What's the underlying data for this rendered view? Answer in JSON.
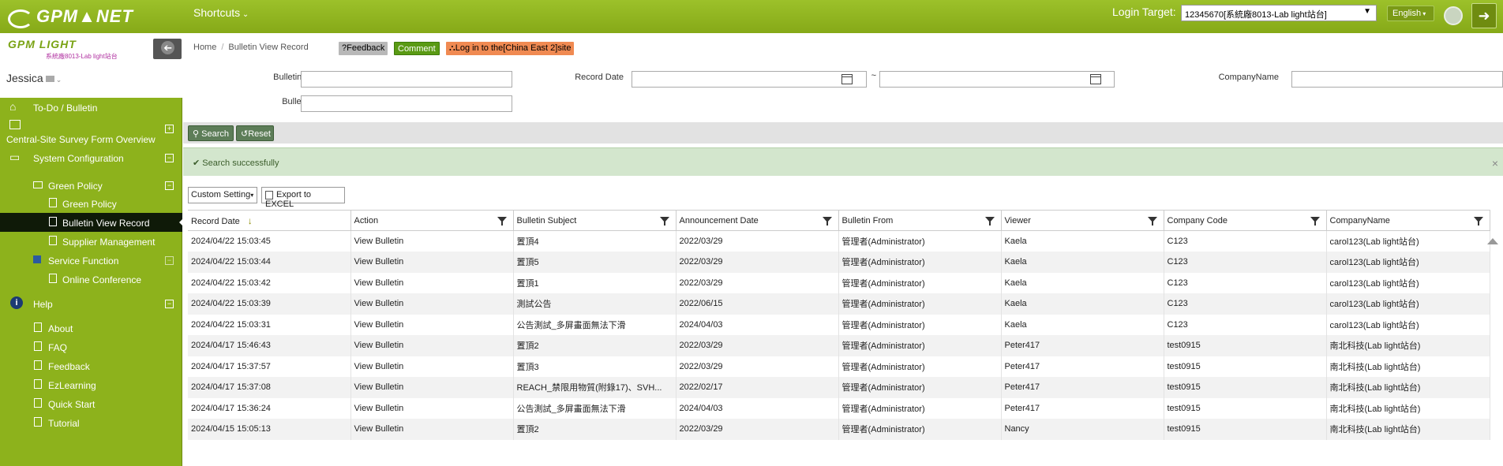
{
  "header": {
    "logo_text": "GPM▲NET",
    "shortcuts_label": "Shortcuts",
    "login_target_label": "Login Target:",
    "login_target_value": "12345670[系統廠8013-Lab light站台]",
    "language": "English",
    "colors": {
      "brand": "#8db21c",
      "dark": "#0f1a08"
    }
  },
  "sidebar": {
    "brand": "GPM LIGHT",
    "brand_sub": "系統廠8013-Lab light站台",
    "user_name": "Jessica",
    "items": [
      {
        "label": "To-Do / Bulletin",
        "icon": "home-icon"
      },
      {
        "label": "Central-Site Survey Form Overview",
        "icon": "pencil-icon",
        "toggle": "+"
      },
      {
        "label": "System Configuration",
        "icon": "monitor-icon",
        "toggle": "−"
      },
      {
        "label": "Green Policy",
        "icon": "folder-icon",
        "toggle": "−"
      },
      {
        "label": "Green Policy",
        "icon": "file-icon"
      },
      {
        "label": "Bulletin View Record",
        "icon": "file-icon",
        "active": true
      },
      {
        "label": "Supplier Management",
        "icon": "file-icon"
      },
      {
        "label": "Service Function",
        "icon": "book-icon",
        "toggle": "−"
      },
      {
        "label": "Online Conference",
        "icon": "file-icon"
      },
      {
        "label": "Help",
        "icon": "info-icon",
        "toggle": "−"
      },
      {
        "label": "About",
        "icon": "file-icon"
      },
      {
        "label": "FAQ",
        "icon": "file-icon"
      },
      {
        "label": "Feedback",
        "icon": "file-icon"
      },
      {
        "label": "EzLearning",
        "icon": "file-icon"
      },
      {
        "label": "Quick Start",
        "icon": "file-icon"
      },
      {
        "label": "Tutorial",
        "icon": "file-icon"
      }
    ]
  },
  "breadcrumb": {
    "home": "Home",
    "current": "Bulletin View Record"
  },
  "badges": {
    "feedback": "?Feedback",
    "comment": "Comment",
    "login": "Log in to the[China East 2]site"
  },
  "filters": {
    "bulletin_subject_label": "Bulletin Subject",
    "bulletin_subject_value": "",
    "record_date_label": "Record Date",
    "record_date_from": "",
    "record_date_sep": "~",
    "record_date_to": "",
    "company_name_label": "CompanyName",
    "company_name_value": "",
    "bulletin_from_label": "Bulletin From",
    "bulletin_from_value": ""
  },
  "actions": {
    "search": "Search",
    "reset": "Reset",
    "custom_setting": "Custom Setting",
    "export": "Export to EXCEL"
  },
  "message": "Search successfully",
  "table": {
    "columns": [
      "Record Date",
      "Action",
      "Bulletin Subject",
      "Announcement Date",
      "Bulletin From",
      "Viewer",
      "Company Code",
      "CompanyName"
    ],
    "rows": [
      [
        "2024/04/22 15:03:45",
        "View Bulletin",
        "置頂4",
        "2022/03/29",
        "管理者(Administrator)",
        "Kaela",
        "C123",
        "carol123(Lab light站台)"
      ],
      [
        "2024/04/22 15:03:44",
        "View Bulletin",
        "置頂5",
        "2022/03/29",
        "管理者(Administrator)",
        "Kaela",
        "C123",
        "carol123(Lab light站台)"
      ],
      [
        "2024/04/22 15:03:42",
        "View Bulletin",
        "置頂1",
        "2022/03/29",
        "管理者(Administrator)",
        "Kaela",
        "C123",
        "carol123(Lab light站台)"
      ],
      [
        "2024/04/22 15:03:39",
        "View Bulletin",
        "測試公告",
        "2022/06/15",
        "管理者(Administrator)",
        "Kaela",
        "C123",
        "carol123(Lab light站台)"
      ],
      [
        "2024/04/22 15:03:31",
        "View Bulletin",
        "公告測試_多屏畫面無法下滑",
        "2024/04/03",
        "管理者(Administrator)",
        "Kaela",
        "C123",
        "carol123(Lab light站台)"
      ],
      [
        "2024/04/17 15:46:43",
        "View Bulletin",
        "置頂2",
        "2022/03/29",
        "管理者(Administrator)",
        "Peter417",
        "test0915",
        "南北科技(Lab light站台)"
      ],
      [
        "2024/04/17 15:37:57",
        "View Bulletin",
        "置頂3",
        "2022/03/29",
        "管理者(Administrator)",
        "Peter417",
        "test0915",
        "南北科技(Lab light站台)"
      ],
      [
        "2024/04/17 15:37:08",
        "View Bulletin",
        "REACH_禁限用物質(附錄17)、SVH...",
        "2022/02/17",
        "管理者(Administrator)",
        "Peter417",
        "test0915",
        "南北科技(Lab light站台)"
      ],
      [
        "2024/04/17 15:36:24",
        "View Bulletin",
        "公告測試_多屏畫面無法下滑",
        "2024/04/03",
        "管理者(Administrator)",
        "Peter417",
        "test0915",
        "南北科技(Lab light站台)"
      ],
      [
        "2024/04/15 15:05:13",
        "View Bulletin",
        "置頂2",
        "2022/03/29",
        "管理者(Administrator)",
        "Nancy",
        "test0915",
        "南北科技(Lab light站台)"
      ]
    ]
  }
}
